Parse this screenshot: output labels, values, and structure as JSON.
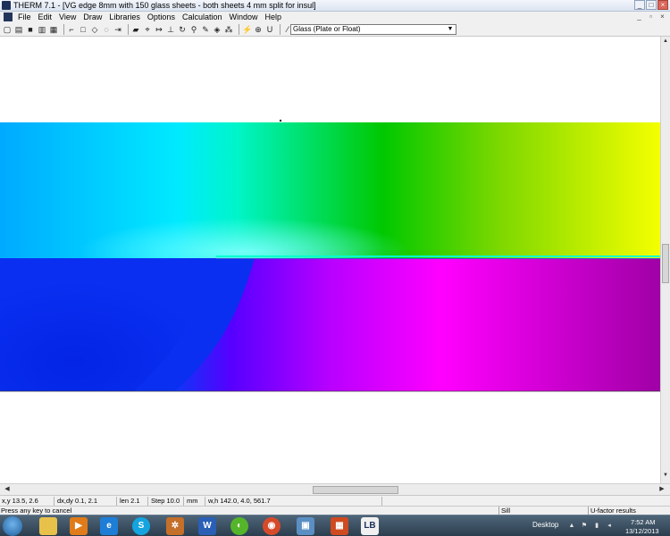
{
  "window": {
    "title": "THERM 7.1 - [VG edge 8mm with 150 glass sheets - both sheets 4 mm  split for insul]",
    "controls": [
      "_",
      "□",
      "×"
    ]
  },
  "menu": {
    "items": [
      "File",
      "Edit",
      "View",
      "Draw",
      "Libraries",
      "Options",
      "Calculation",
      "Window",
      "Help"
    ],
    "mdi_controls": [
      "_",
      "▫",
      "×"
    ]
  },
  "toolbar": {
    "icons": [
      "new-icon",
      "open-icon",
      "save-icon",
      "print-icon",
      "calc-icon",
      "polygon-icon",
      "rectangle-icon",
      "point-icon",
      "arc-icon",
      "locate-icon",
      "fill-void-icon",
      "boundary-icon",
      "pan-icon",
      "rotate-icon",
      "zoom-icon",
      "pick-material-icon",
      "flip-icon",
      "drag-icon",
      "calculate-icon",
      "results-icon",
      "u-factor-icon",
      "help-icon"
    ],
    "material_value": "Glass (Plate or Float)"
  },
  "results": {
    "type": "isotherm-color-flood"
  },
  "coordbar": {
    "xy": "x,y  13.5,  2.6",
    "dxdy": "dx,dy  0.1,  2.1",
    "len": "len  2.1",
    "step": "Step  10.0",
    "units": "mm",
    "wh": "w,h 142.0,  4.0,  561.7"
  },
  "statusbar": {
    "message": "Press any key to cancel",
    "boundary": "Sill",
    "ufactor": "U-factor results"
  },
  "taskbar": {
    "desktop_label": "Desktop",
    "time": "7:52 AM",
    "date": "13/12/2013",
    "apps": [
      "explorer-icon",
      "media-player-icon",
      "ie-icon",
      "skype-icon",
      "generic-app-icon",
      "word-icon",
      "dragon-icon",
      "chrome-icon",
      "window-icon",
      "office-icon",
      "therm-icon"
    ]
  },
  "colors": {
    "gradient_stops": [
      "#0d2fe6",
      "#00c5ff",
      "#00ffff",
      "#00d400",
      "#8be000",
      "#f8ff00",
      "#8000ff",
      "#ff00ff",
      "#a600a6"
    ]
  }
}
